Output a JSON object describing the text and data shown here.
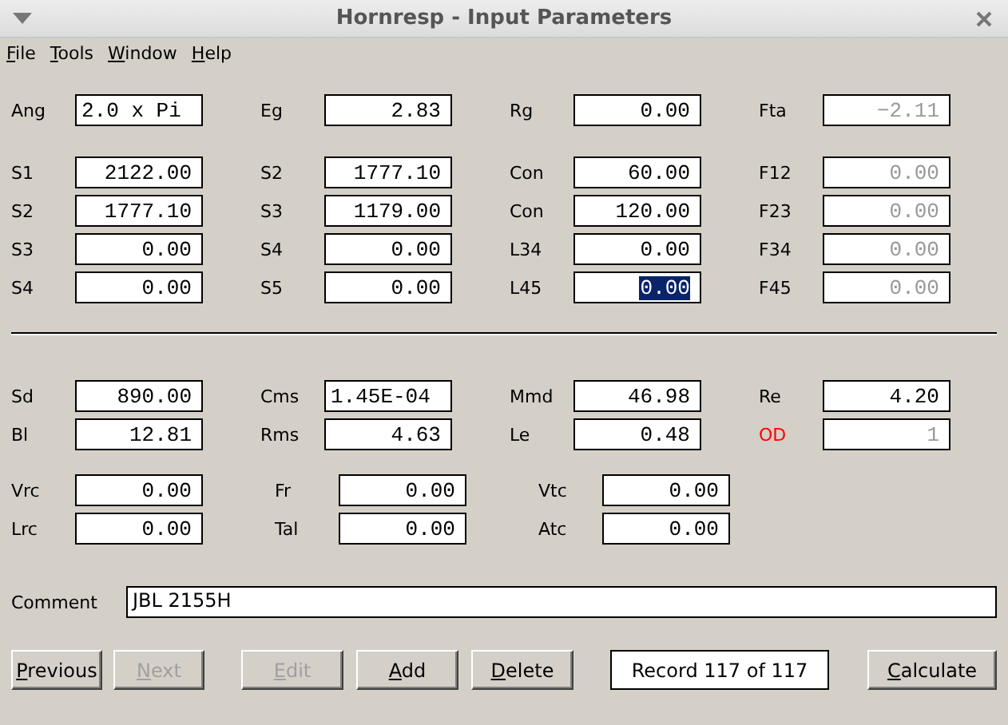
{
  "window": {
    "title": "Hornresp - Input Parameters"
  },
  "menu": [
    "File",
    "Tools",
    "Window",
    "Help"
  ],
  "upper_groups": [
    [
      [
        {
          "label": "Ang",
          "value": "2.0 x Pi",
          "kind": "text",
          "disabled": false,
          "selected": false,
          "alert": false
        },
        {
          "label": "Eg",
          "value": "2.83",
          "kind": "number",
          "disabled": false,
          "selected": false,
          "alert": false
        },
        {
          "label": "Rg",
          "value": "0.00",
          "kind": "number",
          "disabled": false,
          "selected": false,
          "alert": false
        },
        {
          "label": "Fta",
          "value": "−2.11",
          "kind": "number",
          "disabled": true,
          "selected": false,
          "alert": false
        }
      ]
    ],
    [
      [
        {
          "label": "S1",
          "value": "2122.00",
          "kind": "number",
          "disabled": false,
          "selected": false,
          "alert": false
        },
        {
          "label": "S2",
          "value": "1777.10",
          "kind": "number",
          "disabled": false,
          "selected": false,
          "alert": false
        },
        {
          "label": "Con",
          "value": "60.00",
          "kind": "number",
          "disabled": false,
          "selected": false,
          "alert": false
        },
        {
          "label": "F12",
          "value": "0.00",
          "kind": "number",
          "disabled": true,
          "selected": false,
          "alert": false
        }
      ],
      [
        {
          "label": "S2",
          "value": "1777.10",
          "kind": "number",
          "disabled": false,
          "selected": false,
          "alert": false
        },
        {
          "label": "S3",
          "value": "1179.00",
          "kind": "number",
          "disabled": false,
          "selected": false,
          "alert": false
        },
        {
          "label": "Con",
          "value": "120.00",
          "kind": "number",
          "disabled": false,
          "selected": false,
          "alert": false
        },
        {
          "label": "F23",
          "value": "0.00",
          "kind": "number",
          "disabled": true,
          "selected": false,
          "alert": false
        }
      ],
      [
        {
          "label": "S3",
          "value": "0.00",
          "kind": "number",
          "disabled": false,
          "selected": false,
          "alert": false
        },
        {
          "label": "S4",
          "value": "0.00",
          "kind": "number",
          "disabled": false,
          "selected": false,
          "alert": false
        },
        {
          "label": "L34",
          "value": "0.00",
          "kind": "number",
          "disabled": false,
          "selected": false,
          "alert": false
        },
        {
          "label": "F34",
          "value": "0.00",
          "kind": "number",
          "disabled": true,
          "selected": false,
          "alert": false
        }
      ],
      [
        {
          "label": "S4",
          "value": "0.00",
          "kind": "number",
          "disabled": false,
          "selected": false,
          "alert": false
        },
        {
          "label": "S5",
          "value": "0.00",
          "kind": "number",
          "disabled": false,
          "selected": false,
          "alert": false
        },
        {
          "label": "L45",
          "value": "0.00",
          "kind": "number",
          "disabled": false,
          "selected": true,
          "alert": false
        },
        {
          "label": "F45",
          "value": "0.00",
          "kind": "number",
          "disabled": true,
          "selected": false,
          "alert": false
        }
      ]
    ]
  ],
  "lower_groups": [
    [
      [
        {
          "label": "Sd",
          "value": "890.00",
          "kind": "number",
          "disabled": false,
          "selected": false,
          "alert": false
        },
        {
          "label": "Cms",
          "value": "1.45E-04",
          "kind": "text",
          "disabled": false,
          "selected": false,
          "alert": false
        },
        {
          "label": "Mmd",
          "value": "46.98",
          "kind": "number",
          "disabled": false,
          "selected": false,
          "alert": false
        },
        {
          "label": "Re",
          "value": "4.20",
          "kind": "number",
          "disabled": false,
          "selected": false,
          "alert": false
        }
      ],
      [
        {
          "label": "Bl",
          "value": "12.81",
          "kind": "number",
          "disabled": false,
          "selected": false,
          "alert": false
        },
        {
          "label": "Rms",
          "value": "4.63",
          "kind": "number",
          "disabled": false,
          "selected": false,
          "alert": false
        },
        {
          "label": "Le",
          "value": "0.48",
          "kind": "number",
          "disabled": false,
          "selected": false,
          "alert": false
        },
        {
          "label": "OD",
          "value": "1",
          "kind": "number",
          "disabled": true,
          "selected": false,
          "alert": true
        }
      ]
    ],
    [
      [
        {
          "label": "Vrc",
          "value": "0.00",
          "kind": "number",
          "disabled": false,
          "selected": false,
          "alert": false
        },
        {
          "label": "Fr",
          "value": "0.00",
          "kind": "number",
          "disabled": false,
          "selected": false,
          "alert": false
        },
        {
          "label": "Vtc",
          "value": "0.00",
          "kind": "number",
          "disabled": false,
          "selected": false,
          "alert": false
        }
      ],
      [
        {
          "label": "Lrc",
          "value": "0.00",
          "kind": "number",
          "disabled": false,
          "selected": false,
          "alert": false
        },
        {
          "label": "Tal",
          "value": "0.00",
          "kind": "number",
          "disabled": false,
          "selected": false,
          "alert": false
        },
        {
          "label": "Atc",
          "value": "0.00",
          "kind": "number",
          "disabled": false,
          "selected": false,
          "alert": false
        }
      ]
    ]
  ],
  "comment": {
    "label": "Comment",
    "value": "JBL 2155H"
  },
  "buttons": [
    {
      "kind": "button",
      "label": "Previous",
      "disabled": false
    },
    {
      "kind": "button",
      "label": "Next",
      "disabled": true
    },
    {
      "kind": "button",
      "label": "Edit",
      "disabled": true
    },
    {
      "kind": "button",
      "label": "Add",
      "disabled": false
    },
    {
      "kind": "button",
      "label": "Delete",
      "disabled": false
    },
    {
      "kind": "record",
      "label": "Record 117 of 117"
    },
    {
      "kind": "button",
      "label": "Calculate",
      "disabled": false
    }
  ]
}
